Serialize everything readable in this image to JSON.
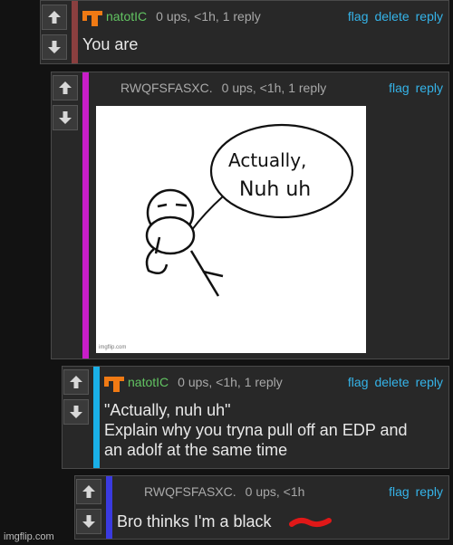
{
  "comments": [
    {
      "user": "natotIC",
      "meta": "0 ups, <1h, 1 reply",
      "actions": [
        "flag",
        "delete",
        "reply"
      ],
      "lines": [
        "You are"
      ]
    },
    {
      "user": "RWQFSFASXC.",
      "meta": "0 ups, <1h, 1 reply",
      "actions": [
        "flag",
        "reply"
      ],
      "image": {
        "bubble_line1": "Actually,",
        "bubble_line2": "Nuh uh",
        "watermark": "imgflip.com"
      }
    },
    {
      "user": "natotIC",
      "meta": "0 ups, <1h, 1 reply",
      "actions": [
        "flag",
        "delete",
        "reply"
      ],
      "lines": [
        "\"Actually, nuh uh\"",
        "Explain why you tryna pull off an EDP and",
        "an adolf at the same time"
      ]
    },
    {
      "user": "RWQFSFASXC.",
      "meta": "0 ups, <1h",
      "actions": [
        "flag",
        "reply"
      ],
      "lines": [
        "Bro thinks I'm a black"
      ]
    }
  ],
  "watermark": "imgflip.com",
  "colors": {
    "bar1": "#8a3f3f",
    "bar2": "#c81ec8",
    "bar3": "#1ab0e8",
    "bar4": "#3a3ae0",
    "link": "#35b3e8",
    "user": "#62c462"
  }
}
